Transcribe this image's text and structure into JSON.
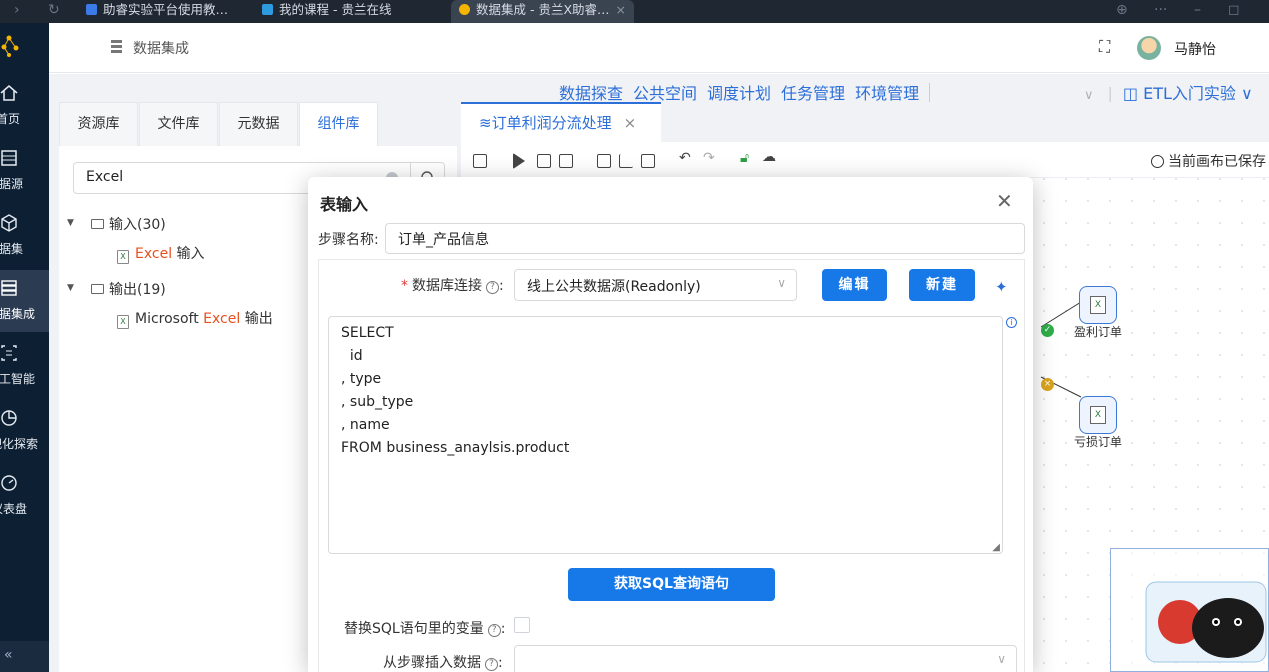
{
  "browser": {
    "tabs": [
      {
        "title": "助睿实验平台使用教…",
        "color": "#3b7be8"
      },
      {
        "title": "我的课程 - 贵兰在线",
        "color": "#2e9ae0"
      },
      {
        "title": "数据集成 - 贵兰X助睿…",
        "color": "#f4b400"
      }
    ]
  },
  "sidebar": {
    "items": [
      {
        "label": "首页",
        "icon": "home-icon"
      },
      {
        "label": "数据源",
        "icon": "datasource-icon"
      },
      {
        "label": "数据集",
        "icon": "dataset-icon"
      },
      {
        "label": "数据集成",
        "icon": "integration-icon"
      },
      {
        "label": "人工智能",
        "icon": "ai-icon"
      },
      {
        "label": "可视化探索",
        "icon": "chart-icon"
      },
      {
        "label": "仪表盘",
        "icon": "dashboard-icon"
      }
    ],
    "collapse": "«"
  },
  "header": {
    "title": "数据集成",
    "user": "马静怡"
  },
  "topmenu": {
    "items": [
      "数据探查",
      "公共空间",
      "调度计划",
      "任务管理",
      "环境管理"
    ],
    "project": "ETL入门实验"
  },
  "leftpanel": {
    "tabs": [
      "资源库",
      "文件库",
      "元数据",
      "组件库"
    ],
    "search_value": "Excel",
    "tree": {
      "input_group": "输入(30)",
      "input_item_pre": "",
      "input_item_hl": "Excel",
      "input_item_post": " 输入",
      "output_group": "输出(19)",
      "output_item_pre": "Microsoft ",
      "output_item_hl": "Excel",
      "output_item_post": " 输出"
    }
  },
  "canvas": {
    "tab_title": "订单利润分流处理",
    "saved": "当前画布已保存",
    "nodes": {
      "profit": "盈利订单",
      "loss": "亏损订单"
    }
  },
  "modal": {
    "title": "表输入",
    "step_name_label": "步骤名称:",
    "step_name_value": "订单_产品信息",
    "db_conn_label": "数据库连接",
    "db_conn_value": "线上公共数据源(Readonly)",
    "edit_btn": "编辑",
    "new_btn": "新建",
    "sql_lines": [
      "SELECT",
      "  id",
      ", type",
      ", sub_type",
      ", name",
      "FROM business_anaylsis.product"
    ],
    "get_sql_btn": "获取SQL查询语句",
    "replace_var_label": "替换SQL语句里的变量",
    "insert_from_step_label": "从步骤插入数据"
  },
  "colors": {
    "primary": "#1778e8",
    "sidebar_bg": "#0d1f33",
    "highlight": "#e8501f"
  }
}
